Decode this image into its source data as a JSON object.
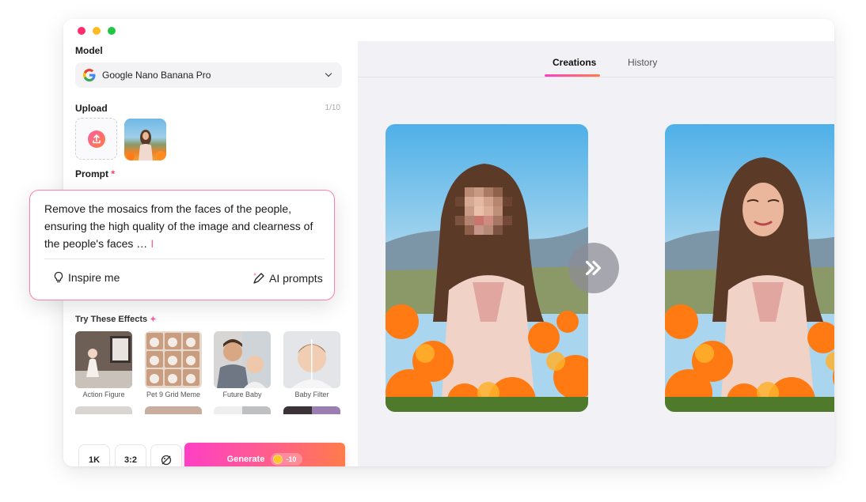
{
  "window": {
    "controls": [
      "close",
      "minimize",
      "maximize"
    ]
  },
  "left_panel": {
    "model_label": "Model",
    "model_value": "Google Nano Banana Pro",
    "upload_label": "Upload",
    "upload_count": "1/10",
    "prompt_label": "Prompt",
    "prompt_required": "*",
    "effects_title": "Try These Effects",
    "effects": [
      {
        "label": "Action Figure"
      },
      {
        "label": "Pet 9 Grid Meme"
      },
      {
        "label": "Future Baby"
      },
      {
        "label": "Baby Filter"
      }
    ],
    "bottom": {
      "resolution": "1K",
      "ratio": "3:2",
      "generate_label": "Generate",
      "cost": "-10"
    }
  },
  "prompt_card": {
    "text": "Remove the mosaics from the faces of the people, ensuring the high quality of the image and clearness of the people's faces …",
    "inspire_label": "Inspire me",
    "ai_prompts_label": "AI prompts"
  },
  "right_panel": {
    "tabs": [
      {
        "label": "Creations",
        "active": true
      },
      {
        "label": "History",
        "active": false
      }
    ]
  },
  "colors": {
    "accent_gradient_start": "#ff3fc4",
    "accent_gradient_end": "#ff7c4a",
    "required_star": "#ff3b58"
  }
}
